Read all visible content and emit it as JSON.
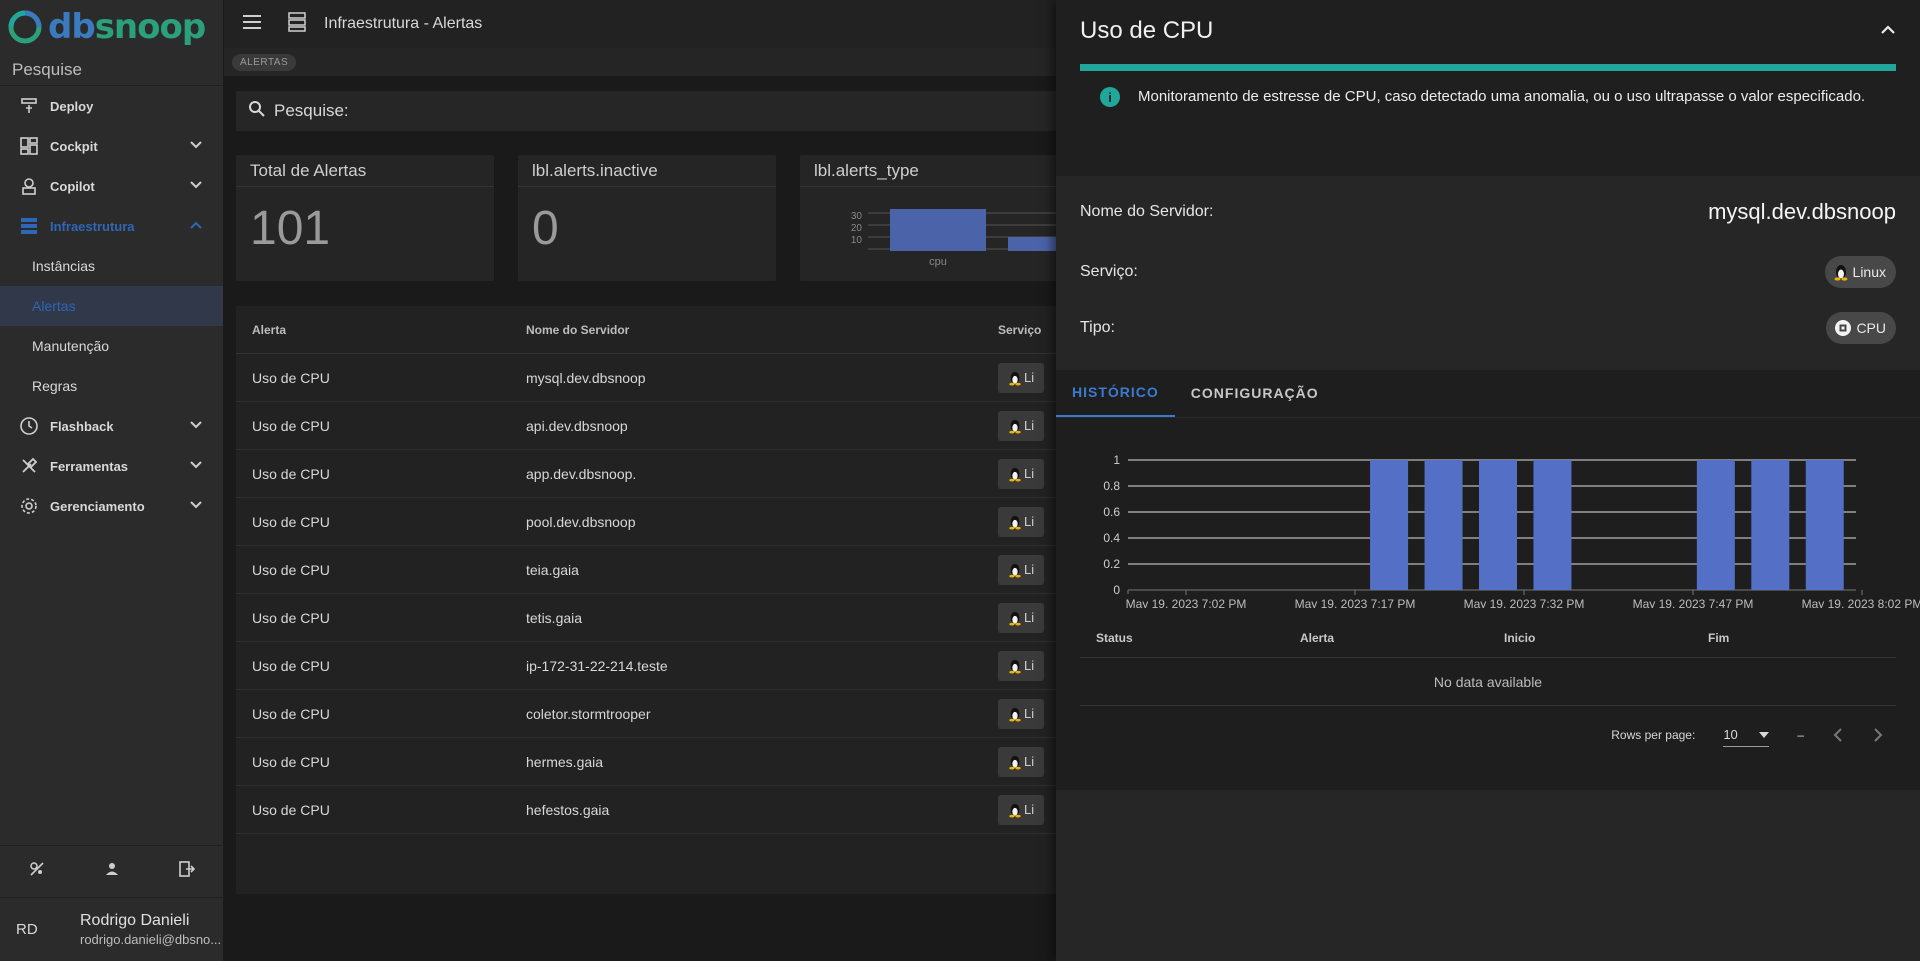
{
  "app": {
    "logo_db": "db",
    "logo_snoop": "snoop"
  },
  "sidebar": {
    "search_placeholder": "Pesquise",
    "items": [
      {
        "label": "Deploy",
        "icon": "deploy-icon"
      },
      {
        "label": "Cockpit",
        "icon": "dashboard-icon"
      },
      {
        "label": "Copilot",
        "icon": "robot-icon"
      },
      {
        "label": "Infraestrutura",
        "icon": "server-icon"
      },
      {
        "label": "Flashback",
        "icon": "clock-icon"
      },
      {
        "label": "Ferramentas",
        "icon": "tools-icon"
      },
      {
        "label": "Gerenciamento",
        "icon": "gear-icon"
      }
    ],
    "sub_items": [
      "Instâncias",
      "Alertas",
      "Manutenção",
      "Regras"
    ],
    "user": {
      "initials": "RD",
      "name": "Rodrigo Danieli",
      "email": "rodrigo.danieli@dbsno..."
    }
  },
  "topbar": {
    "title": "Infraestrutura - Alertas",
    "breadcrumb": "ALERTAS"
  },
  "search": {
    "placeholder": "Pesquise:"
  },
  "cards": {
    "total_title": "Total de Alertas",
    "total_value": "101",
    "inactive_title": "lbl.alerts.inactive",
    "inactive_value": "0",
    "type_title": "lbl.alerts_type",
    "mini_chart": {
      "ticks": [
        "30",
        "20",
        "10"
      ],
      "label": "cpu"
    }
  },
  "table": {
    "headers": {
      "alert": "Alerta",
      "server": "Nome do Servidor",
      "service": "Serviço"
    },
    "chip_text": "Li",
    "rows": [
      {
        "alert": "Uso de CPU",
        "server": "mysql.dev.dbsnoop"
      },
      {
        "alert": "Uso de CPU",
        "server": "api.dev.dbsnoop"
      },
      {
        "alert": "Uso de CPU",
        "server": "app.dev.dbsnoop."
      },
      {
        "alert": "Uso de CPU",
        "server": "pool.dev.dbsnoop"
      },
      {
        "alert": "Uso de CPU",
        "server": "teia.gaia"
      },
      {
        "alert": "Uso de CPU",
        "server": "tetis.gaia"
      },
      {
        "alert": "Uso de CPU",
        "server": "ip-172-31-22-214.teste"
      },
      {
        "alert": "Uso de CPU",
        "server": "coletor.stormtrooper"
      },
      {
        "alert": "Uso de CPU",
        "server": "hermes.gaia"
      },
      {
        "alert": "Uso de CPU",
        "server": "hefestos.gaia"
      }
    ]
  },
  "panel": {
    "title": "Uso de CPU",
    "info_icon": "i",
    "info_text": "Monitoramento de estresse de CPU, caso detectado uma anomalia, ou o uso ultrapasse o valor especificado.",
    "server_label": "Nome do Servidor:",
    "server_value": "mysql.dev.dbsnoop",
    "service_label": "Serviço:",
    "service_value": "Linux",
    "type_label": "Tipo:",
    "type_value": "CPU",
    "tabs": [
      "HISTÓRICO",
      "CONFIGURAÇÃO"
    ],
    "history_headers": [
      "Status",
      "Alerta",
      "Inicio",
      "Fim"
    ],
    "no_data": "No data available",
    "rows_per_page_label": "Rows per page:",
    "rows_per_page_value": "10",
    "page_range": "–"
  },
  "chart_data": {
    "type": "bar",
    "ylim": [
      0,
      1
    ],
    "y_ticks": [
      "0",
      "0.2",
      "0.4",
      "0.6",
      "0.8",
      "1"
    ],
    "x_tick_labels": [
      "May 19, 2023 7:02 PM",
      "May 19, 2023 7:17 PM",
      "May 19, 2023 7:32 PM",
      "May 19, 2023 7:47 PM",
      "May 19, 2023 8:02 PM"
    ],
    "bars": [
      {
        "slot": 0,
        "value": 0
      },
      {
        "slot": 1,
        "value": 0
      },
      {
        "slot": 2,
        "value": 0
      },
      {
        "slot": 3,
        "value": 0
      },
      {
        "slot": 4,
        "value": 1
      },
      {
        "slot": 5,
        "value": 1
      },
      {
        "slot": 6,
        "value": 1
      },
      {
        "slot": 7,
        "value": 1
      },
      {
        "slot": 8,
        "value": 0
      },
      {
        "slot": 9,
        "value": 0
      },
      {
        "slot": 10,
        "value": 1
      },
      {
        "slot": 11,
        "value": 1
      },
      {
        "slot": 12,
        "value": 1
      }
    ],
    "bar_color": "#5470c6",
    "grid": true
  },
  "colors": {
    "accent": "#3a7ad0",
    "teal": "#20a69a",
    "brand_blue": "#3a7bbf",
    "brand_green": "#2aa17b"
  }
}
